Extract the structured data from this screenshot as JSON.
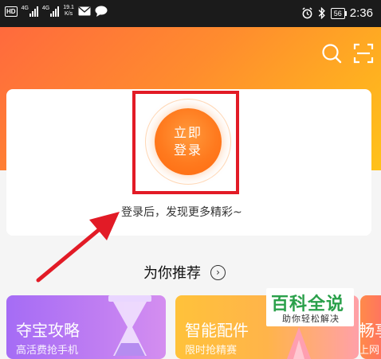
{
  "status_bar": {
    "hd_badge": "HD",
    "network_1": "4G",
    "network_2": "4G",
    "speed_value": "19.1",
    "speed_unit": "K/s",
    "battery_level": "56",
    "time": "2:36"
  },
  "header": {
    "search_icon": "search-icon",
    "scan_icon": "scan-icon",
    "accent_color": "#ff7a1e"
  },
  "login": {
    "button_label": "立即登录",
    "hint": "登录后，发现更多精彩~",
    "highlight_color": "#e21b26"
  },
  "recommend": {
    "title": "为你推荐",
    "more_icon": "chevron-right-icon"
  },
  "cards": [
    {
      "title": "夺宝攻略",
      "subtitle": "高活费抢手机"
    },
    {
      "title": "智能配件",
      "subtitle": "限时抢精赛"
    },
    {
      "title": "畅享",
      "subtitle": "上网"
    }
  ],
  "watermark": {
    "main": "百科全说",
    "sub": "助你轻松解决"
  }
}
